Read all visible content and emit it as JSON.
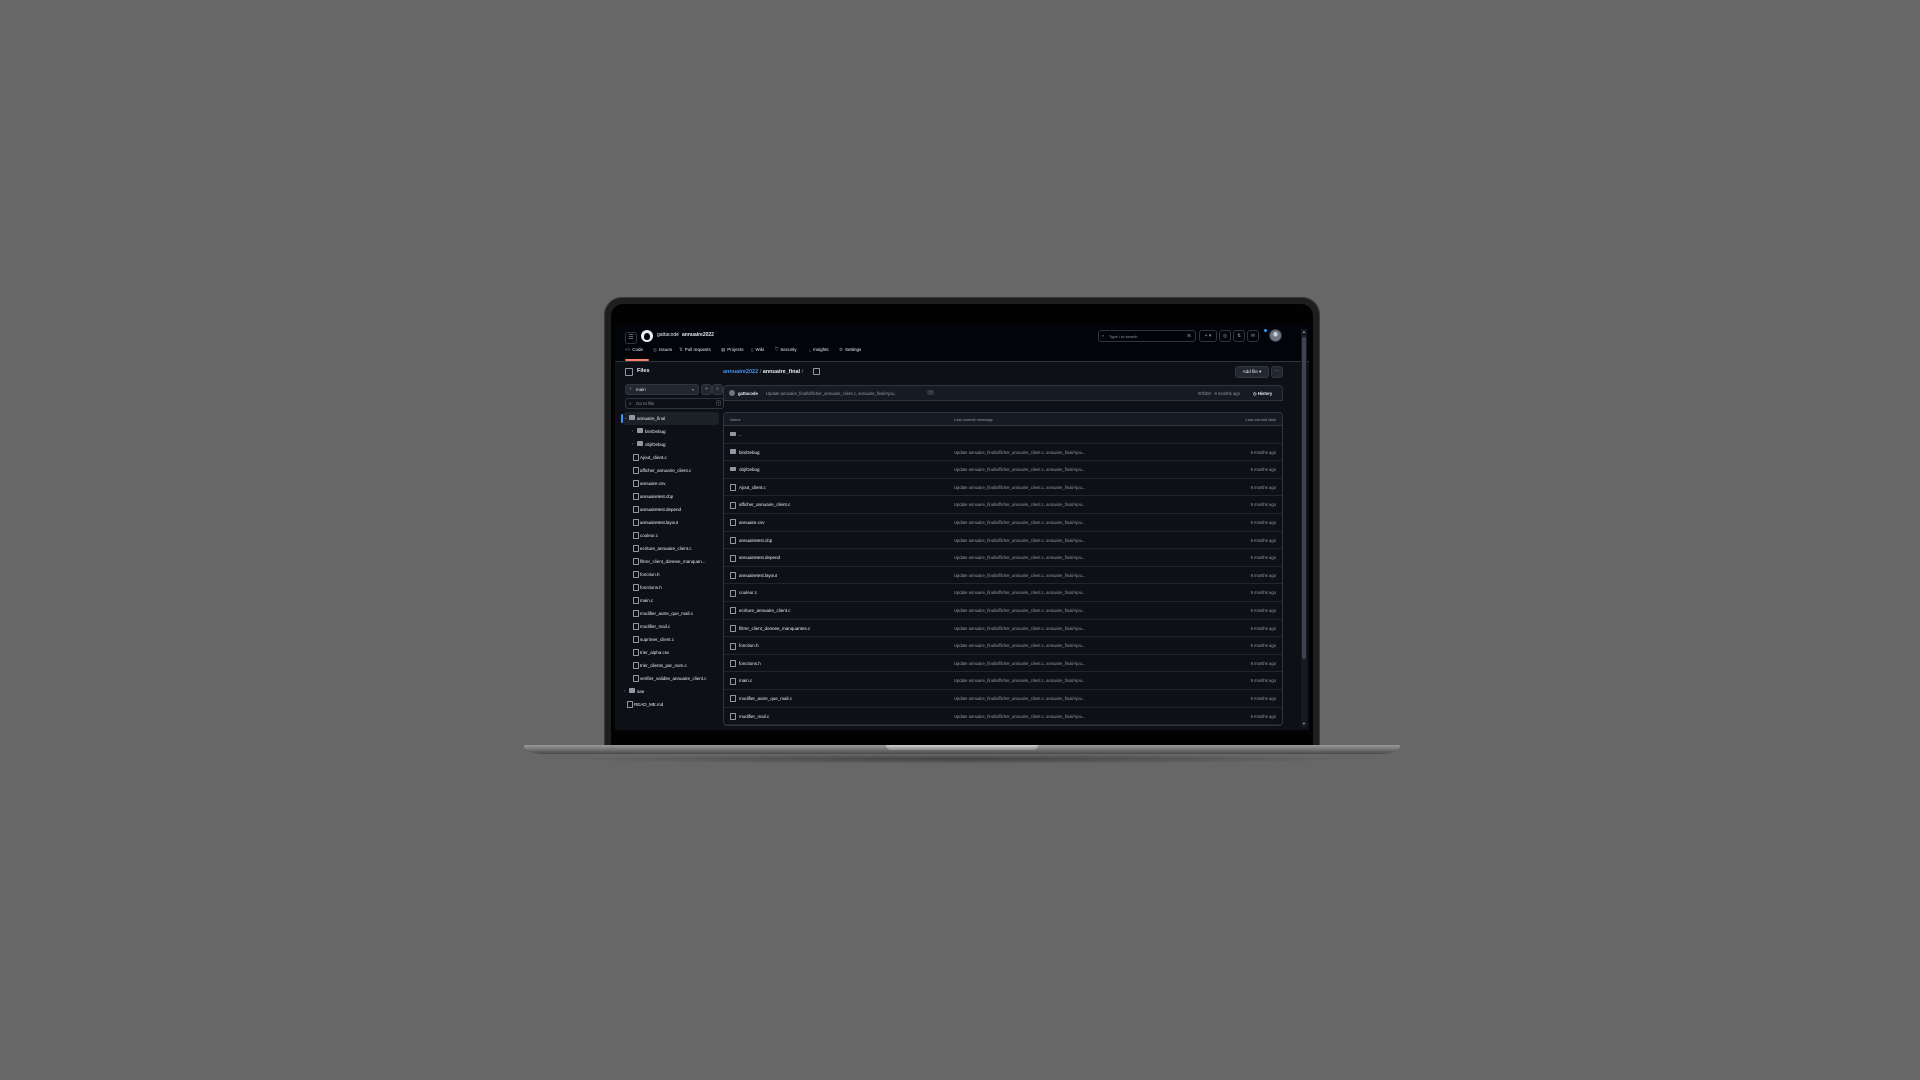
{
  "header": {
    "owner": "gattacode",
    "separator": "/",
    "repo": "annuaire2022",
    "search_placeholder": "Type / to search",
    "search_cmd": "⌘.",
    "plus_label": "+ ▾"
  },
  "repo_nav": {
    "tabs": [
      {
        "label": "Code",
        "icon": "code-icon"
      },
      {
        "label": "Issues",
        "icon": "issue-icon"
      },
      {
        "label": "Pull requests",
        "icon": "pull-request-icon"
      },
      {
        "label": "Projects",
        "icon": "table-icon"
      },
      {
        "label": "Wiki",
        "icon": "book-icon"
      },
      {
        "label": "Security",
        "icon": "shield-icon"
      },
      {
        "label": "Insights",
        "icon": "graph-icon"
      },
      {
        "label": "Settings",
        "icon": "gear-icon"
      }
    ]
  },
  "sidebar": {
    "title": "Files",
    "branch": "main",
    "goto_placeholder": "Go to file",
    "goto_key": "t",
    "tree": [
      {
        "label": "annuaire_final",
        "type": "folder",
        "expanded": true,
        "active": true
      },
      {
        "label": "bin/Debug",
        "type": "folder"
      },
      {
        "label": "obj/Debug",
        "type": "folder"
      },
      {
        "label": "Ajout_client.c",
        "type": "file"
      },
      {
        "label": "afficher_annuaire_client.c",
        "type": "file"
      },
      {
        "label": "annuaire.csv",
        "type": "file"
      },
      {
        "label": "annuairetest.cbp",
        "type": "file"
      },
      {
        "label": "annuairetest.depend",
        "type": "file"
      },
      {
        "label": "annuairetest.layout",
        "type": "file"
      },
      {
        "label": "couleur.c",
        "type": "file"
      },
      {
        "label": "ecriture_annuaire_client.c",
        "type": "file"
      },
      {
        "label": "filtrer_client_donnee_manquan...",
        "type": "file"
      },
      {
        "label": "fonction.h",
        "type": "file"
      },
      {
        "label": "fonctions.h",
        "type": "file"
      },
      {
        "label": "main.c",
        "type": "file"
      },
      {
        "label": "modifier_autre_que_mail.c",
        "type": "file"
      },
      {
        "label": "modifier_mail.c",
        "type": "file"
      },
      {
        "label": "suprimer_client.c",
        "type": "file"
      },
      {
        "label": "trier_alpha.csv",
        "type": "file"
      },
      {
        "label": "trier_clients_par_nom.c",
        "type": "file"
      },
      {
        "label": "verifier_validite_annuaire_client.c",
        "type": "file"
      },
      {
        "label": "sae",
        "type": "folder-root"
      },
      {
        "label": "READ_ME.md",
        "type": "file-root"
      }
    ]
  },
  "main": {
    "path": {
      "repo": "annuaire2022",
      "sep": " / ",
      "dir": "annuaire_final",
      "trail": " /"
    },
    "add_file": "Add file ▾",
    "more": "···",
    "commit": {
      "author": "gattacode",
      "message": "Update annuaire_final/afficher_annuaire_client.c, annuaire_final/Ajou...",
      "badge": "···",
      "meta": "00f1b0 · 9 months ago",
      "history": "History"
    },
    "table": {
      "headers": {
        "name": "Name",
        "message": "Last commit message",
        "date": "Last commit date"
      },
      "rows": [
        {
          "name": "..",
          "type": "folder",
          "message": "",
          "date": ""
        },
        {
          "name": "bin/Debug",
          "type": "folder",
          "message": "Update annuaire_final/afficher_annuaire_client.c, annuaire_final/Ajou...",
          "date": "9 months ago"
        },
        {
          "name": "obj/Debug",
          "type": "folder",
          "message": "Update annuaire_final/afficher_annuaire_client.c, annuaire_final/Ajou...",
          "date": "9 months ago"
        },
        {
          "name": "Ajout_client.c",
          "type": "file",
          "message": "Update annuaire_final/afficher_annuaire_client.c, annuaire_final/Ajou...",
          "date": "9 months ago"
        },
        {
          "name": "afficher_annuaire_client.c",
          "type": "file",
          "message": "Update annuaire_final/afficher_annuaire_client.c, annuaire_final/Ajou...",
          "date": "9 months ago"
        },
        {
          "name": "annuaire.csv",
          "type": "file",
          "message": "Update annuaire_final/afficher_annuaire_client.c, annuaire_final/Ajou...",
          "date": "9 months ago"
        },
        {
          "name": "annuairetest.cbp",
          "type": "file",
          "message": "Update annuaire_final/afficher_annuaire_client.c, annuaire_final/Ajou...",
          "date": "9 months ago"
        },
        {
          "name": "annuairetest.depend",
          "type": "file",
          "message": "Update annuaire_final/afficher_annuaire_client.c, annuaire_final/Ajou...",
          "date": "9 months ago"
        },
        {
          "name": "annuairetest.layout",
          "type": "file",
          "message": "Update annuaire_final/afficher_annuaire_client.c, annuaire_final/Ajou...",
          "date": "9 months ago"
        },
        {
          "name": "couleur.c",
          "type": "file",
          "message": "Update annuaire_final/afficher_annuaire_client.c, annuaire_final/Ajou...",
          "date": "9 months ago"
        },
        {
          "name": "ecriture_annuaire_client.c",
          "type": "file",
          "message": "Update annuaire_final/afficher_annuaire_client.c, annuaire_final/Ajou...",
          "date": "9 months ago"
        },
        {
          "name": "filtrer_client_donnee_manquantes.c",
          "type": "file",
          "message": "Update annuaire_final/afficher_annuaire_client.c, annuaire_final/Ajou...",
          "date": "9 months ago"
        },
        {
          "name": "fonction.h",
          "type": "file",
          "message": "Update annuaire_final/afficher_annuaire_client.c, annuaire_final/Ajou...",
          "date": "9 months ago"
        },
        {
          "name": "fonctions.h",
          "type": "file",
          "message": "Update annuaire_final/afficher_annuaire_client.c, annuaire_final/Ajou...",
          "date": "9 months ago"
        },
        {
          "name": "main.c",
          "type": "file",
          "message": "Update annuaire_final/afficher_annuaire_client.c, annuaire_final/Ajou...",
          "date": "9 months ago"
        },
        {
          "name": "modifier_autre_que_mail.c",
          "type": "file",
          "message": "Update annuaire_final/afficher_annuaire_client.c, annuaire_final/Ajou...",
          "date": "9 months ago"
        },
        {
          "name": "modifier_mail.c",
          "type": "file",
          "message": "Update annuaire_final/afficher_annuaire_client.c, annuaire_final/Ajou...",
          "date": "9 months ago"
        }
      ]
    }
  },
  "colors": {
    "background": "#676767",
    "page_bg": "#0d1117",
    "link": "#4493f8",
    "tab_underline": "#f78166",
    "muted_text": "#9198a1"
  }
}
